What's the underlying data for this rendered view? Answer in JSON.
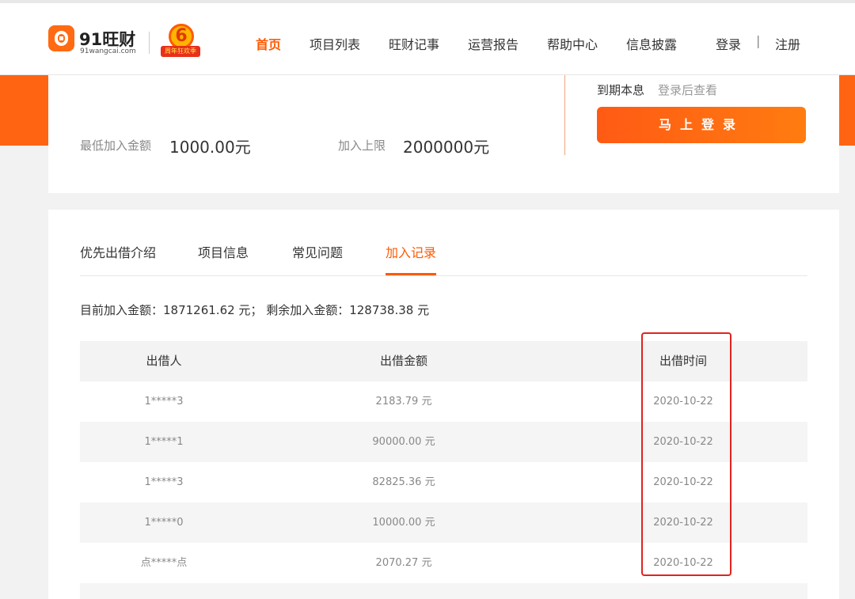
{
  "header": {
    "brand_name": "91旺财",
    "brand_url": "91wangcai.com",
    "promo_number": "6",
    "promo_text": "周年狂欢季",
    "nav": [
      "首页",
      "项目列表",
      "旺财记事",
      "运营报告",
      "帮助中心",
      "信息披露"
    ],
    "active_nav": "首页",
    "login": "登录",
    "separator": "|",
    "register": "注册"
  },
  "summary_card": {
    "min_label": "最低加入金额",
    "min_value": "1000.00元",
    "limit_label": "加入上限",
    "limit_value": "2000000元",
    "due_label": "到期本息",
    "due_value": "登录后查看",
    "login_button": "马上登录"
  },
  "tabs": [
    "优先出借介绍",
    "项目信息",
    "常见问题",
    "加入记录"
  ],
  "active_tab": "加入记录",
  "summary": "目前加入金额：1871261.62 元； 剩余加入金额：128738.38 元",
  "table": {
    "headers": [
      "出借人",
      "出借金额",
      "出借时间"
    ],
    "rows": [
      [
        "1*****3",
        "2183.79 元",
        "2020-10-22"
      ],
      [
        "1*****1",
        "90000.00 元",
        "2020-10-22"
      ],
      [
        "1*****3",
        "82825.36 元",
        "2020-10-22"
      ],
      [
        "1*****0",
        "10000.00 元",
        "2020-10-22"
      ],
      [
        "点*****点",
        "2070.27 元",
        "2020-10-22"
      ]
    ]
  },
  "colors": {
    "accent": "#ff5a00",
    "highlight": "#e0231f"
  }
}
